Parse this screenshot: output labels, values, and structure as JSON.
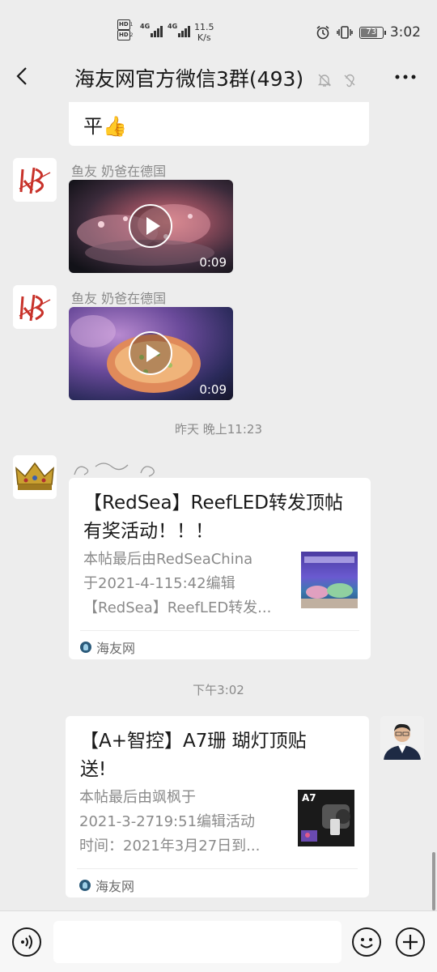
{
  "status_bar": {
    "network_left": "4G",
    "network_right": "4G",
    "speed_value": "11.5",
    "speed_unit": "K/s",
    "battery": "73",
    "time": "3:02"
  },
  "header": {
    "title": "海友网官方微信3群(493)"
  },
  "messages": [
    {
      "type": "text-partial",
      "text": "平👍"
    },
    {
      "type": "video",
      "sender": "鱼友 奶爸在德国",
      "duration": "0:09"
    },
    {
      "type": "video",
      "sender": "鱼友 奶爸在德国",
      "duration": "0:09"
    },
    {
      "type": "timestamp",
      "text": "昨天 晚上11:23"
    },
    {
      "type": "link-card",
      "title": "【RedSea】ReefLED转发顶帖有奖活动！！！",
      "title_line1": "【RedSea】ReefLED转发顶帖",
      "title_line2": "有奖活动！！！",
      "desc_line1": "本帖最后由RedSeaChina",
      "desc_line2": "于2021-4-115:42编辑",
      "desc_line3": "【RedSea】ReefLED转发...",
      "source": "海友网"
    },
    {
      "type": "timestamp",
      "text": "下午3:02"
    },
    {
      "type": "link-card",
      "title_line1": "【A+智控】A7珊 瑚灯顶贴",
      "title_line2": "送!",
      "desc_line1": "本帖最后由飒枫于",
      "desc_line2": "2021-3-2719:51编辑活动",
      "desc_line3": "时间：2021年3月27日到...",
      "thumb_label": "A7",
      "source": "海友网"
    }
  ],
  "colors": {
    "background": "#ededed",
    "bubble": "#ffffff",
    "muted_text": "#8a8a8a"
  }
}
